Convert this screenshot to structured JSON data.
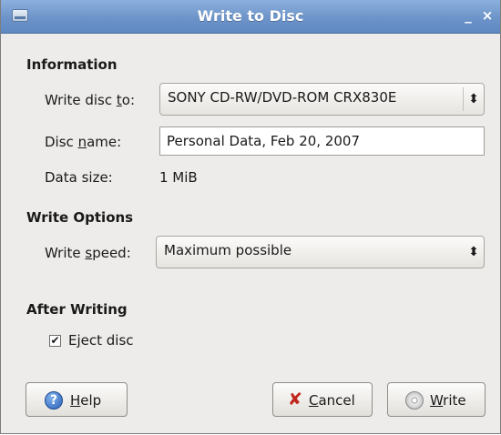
{
  "window": {
    "title": "Write to Disc",
    "minimize_glyph": "_",
    "close_glyph": "×"
  },
  "information": {
    "heading": "Information",
    "write_disc_to": {
      "label_pre": "Write disc ",
      "label_mnemonic": "t",
      "label_post": "o:",
      "value": "SONY CD-RW/DVD-ROM CRX830E",
      "arrow_glyph": "⬍"
    },
    "disc_name": {
      "label_pre": "Disc ",
      "label_mnemonic": "n",
      "label_post": "ame:",
      "value": "Personal Data, Feb 20, 2007"
    },
    "data_size": {
      "label": "Data size:",
      "value": "1 MiB"
    }
  },
  "write_options": {
    "heading": "Write Options",
    "write_speed": {
      "label_pre": "Write ",
      "label_mnemonic": "s",
      "label_post": "peed:",
      "value": "Maximum possible",
      "arrow_glyph": "⬍"
    }
  },
  "after_writing": {
    "heading": "After Writing",
    "eject": {
      "checked": true,
      "check_glyph": "✔",
      "label_pre": "E",
      "label_mnemonic": "j",
      "label_post": "ect disc"
    }
  },
  "buttons": {
    "help": {
      "mnemonic": "H",
      "rest": "elp",
      "icon_glyph": "?"
    },
    "cancel": {
      "mnemonic": "C",
      "rest": "ancel",
      "icon_glyph": "✘"
    },
    "write": {
      "mnemonic": "W",
      "rest": "rite"
    }
  },
  "colors": {
    "titlebar": "#6d94c9",
    "dialog_bg": "#edecea",
    "cancel_icon": "#c0271d",
    "help_icon": "#2d62b8"
  }
}
